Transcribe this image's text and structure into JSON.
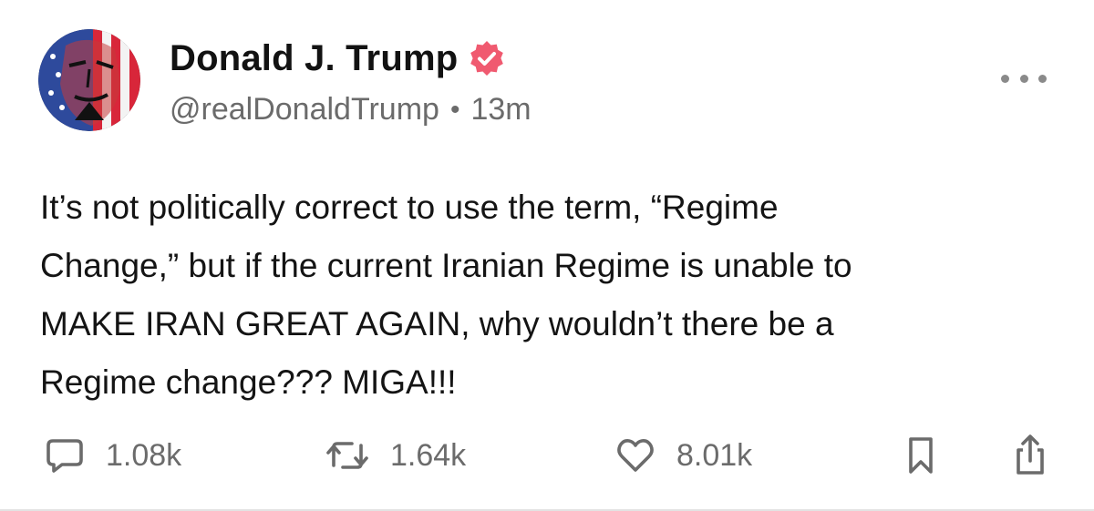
{
  "post": {
    "author": {
      "display_name": "Donald J. Trump",
      "handle": "@realDonaldTrump",
      "separator": "•",
      "time_ago": "13m",
      "verified": true
    },
    "text_lines": [
      "It’s not politically correct to use the term, “Regime",
      "Change,” but if the current Iranian Regime is unable to",
      "MAKE IRAN GREAT AGAIN, why wouldn’t there be a",
      "Regime change??? MIGA!!!"
    ],
    "actions": {
      "reply_count": "1.08k",
      "repost_count": "1.64k",
      "like_count": "8.01k"
    },
    "icons": {
      "more": "more-horizontal-icon",
      "reply": "comment-icon",
      "repost": "repost-icon",
      "like": "heart-icon",
      "bookmark": "bookmark-icon",
      "share": "share-icon",
      "verified": "verified-badge-icon"
    },
    "colors": {
      "verified_badge": "#f05a70",
      "text": "#141414",
      "muted": "#6b6b6b"
    }
  }
}
